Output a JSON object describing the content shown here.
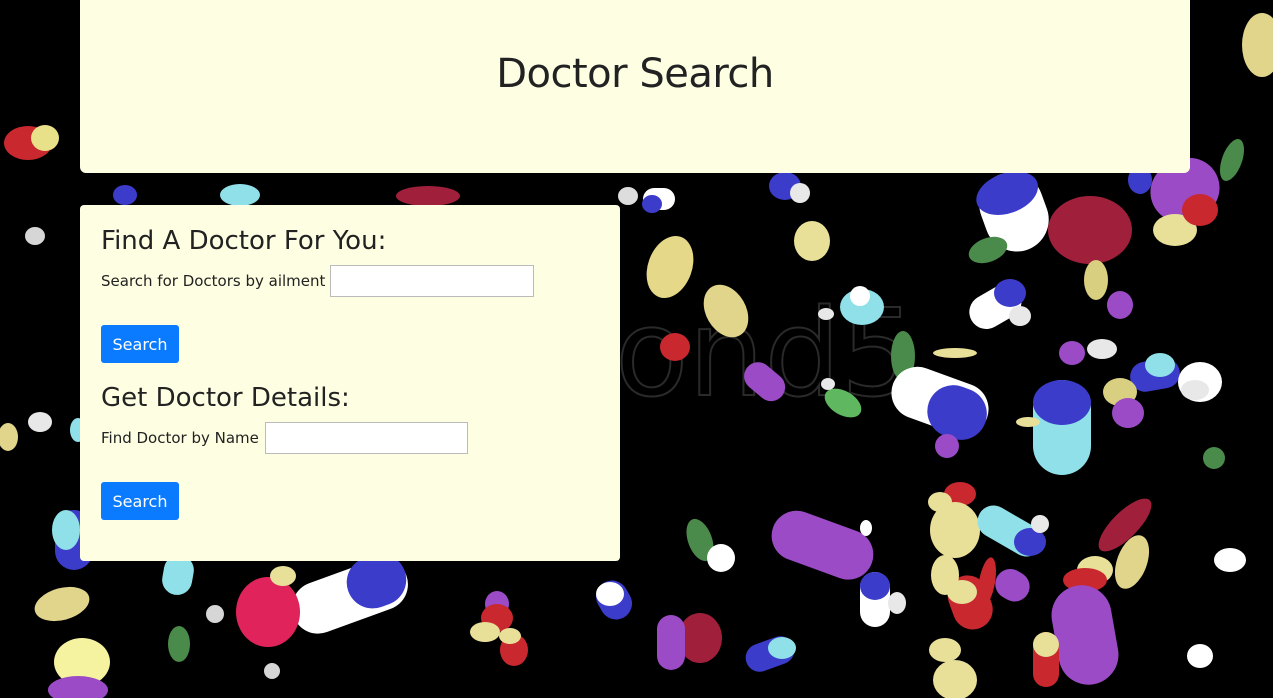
{
  "header": {
    "title": "Doctor Search"
  },
  "find_section": {
    "title": "Find A Doctor For You:",
    "label": "Search for Doctors by ailment",
    "input_value": "",
    "button_label": "Search"
  },
  "details_section": {
    "title": "Get Doctor Details:",
    "label": "Find Doctor by Name",
    "input_value": "",
    "button_label": "Search"
  },
  "background": {
    "description_icon": "pills-background",
    "colors": {
      "page": "#000000",
      "panel": "#fefee2",
      "button": "#0a7bff"
    }
  }
}
